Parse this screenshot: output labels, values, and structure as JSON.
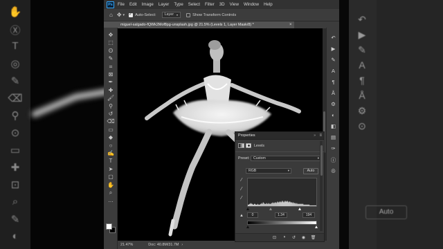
{
  "menubar": {
    "app_icon": "Ps",
    "items": [
      "File",
      "Edit",
      "Image",
      "Layer",
      "Type",
      "Select",
      "Filter",
      "3D",
      "View",
      "Window",
      "Help"
    ]
  },
  "options_bar": {
    "move_icon": "move-tool-icon",
    "auto_select_label": "Auto-Select:",
    "auto_select_target": "Layer",
    "transform_label": "Show Transform Controls",
    "auto_select_checked": true,
    "transform_checked": false
  },
  "document": {
    "tab_title": "miguel-salgado-fQWk2Mof8pg-unsplash.jpg @ 21.5% (Levels 1, Layer Mask/8) *",
    "tab_close": "×"
  },
  "statusbar": {
    "zoom": "21.47%",
    "doc_info": "Doc: 40.8M/31.7M",
    "arrow": "›"
  },
  "properties": {
    "title": "Properties",
    "collapse": "»",
    "menu": "≡",
    "adjustment_label": "Levels",
    "preset_label": "Preset:",
    "preset_value": "Custom",
    "channel_value": "RGB",
    "auto_label": "Auto",
    "input_black": "0",
    "input_gamma": "1.34",
    "input_white": "194",
    "output_black": "0",
    "output_white": "255",
    "caret": "▾"
  },
  "histogram": {
    "description_levels": [
      2,
      2,
      3,
      3,
      4,
      3,
      3,
      2,
      2,
      3,
      3,
      2,
      2,
      2,
      3,
      2,
      2,
      2,
      3,
      3,
      4,
      3,
      5,
      4,
      3,
      3,
      3,
      4,
      3,
      3,
      4,
      3,
      3,
      3,
      4,
      4,
      5,
      4,
      4,
      5,
      5,
      4,
      5,
      6,
      5,
      5,
      6,
      6,
      5,
      6,
      7,
      6,
      5,
      6,
      7,
      6,
      6,
      7,
      6,
      5,
      6,
      6,
      5,
      5,
      5,
      4,
      5,
      4,
      4,
      4,
      3,
      4,
      3,
      3,
      3,
      3,
      3,
      3,
      3,
      3,
      3,
      2,
      2,
      2,
      2,
      2,
      2,
      2,
      2,
      2,
      1,
      1,
      1,
      1,
      1,
      1,
      1,
      1,
      1,
      1
    ]
  },
  "sliders": {
    "input_black_fraction": 0.0,
    "input_gamma_fraction": 0.34,
    "input_white_fraction": 0.76,
    "output_black_fraction": 0.0,
    "output_white_fraction": 1.0
  },
  "icons": {
    "tools_left": [
      "move-icon",
      "artboard-icon",
      "lasso-icon",
      "quick-select-icon",
      "crop-icon",
      "frame-icon",
      "eyedropper-icon",
      "healing-icon",
      "brush-icon",
      "clone-stamp-icon",
      "history-brush-icon",
      "eraser-icon",
      "gradient-icon",
      "blur-icon",
      "dodge-icon",
      "pen-icon",
      "type-icon",
      "path-select-icon",
      "rectangle-icon",
      "hand-icon",
      "zoom-icon",
      "more-tools-icon"
    ],
    "tools_right": [
      "history-icon",
      "play-icon",
      "brush-settings-icon",
      "character-icon",
      "paragraph-icon",
      "glyphs-icon",
      "properties-icon",
      "adjustments-icon",
      "layers-icon",
      "channels-icon",
      "paths-icon",
      "info-icon",
      "libraries-icon"
    ]
  },
  "glyphs": {
    "tools_left": [
      "✥",
      "⬚",
      "ʘ",
      "✎",
      "⌗",
      "⊠",
      "✒",
      "✚",
      "🖌",
      "⚲",
      "↺",
      "⌫",
      "▭",
      "◆",
      "○",
      "✍",
      "T",
      "➤",
      "▢",
      "✋",
      "⌕",
      "…"
    ],
    "tools_right": [
      "↶",
      "▶",
      "✎",
      "A",
      "¶",
      "Å",
      "⚙",
      "◐",
      "◧",
      "▤",
      "✑",
      "ⓘ",
      "◎"
    ],
    "backdrop_left": [
      "✋",
      "Ⓧ",
      "T",
      "◎",
      "✎",
      "⌫",
      "⚲",
      "⊙",
      "▭",
      "✚",
      "⊡",
      "⌕",
      "✎",
      "◐"
    ],
    "backdrop_right": [
      "↶",
      "▶",
      "✎",
      "A",
      "¶",
      "Å",
      "⚙",
      "⊙"
    ],
    "props_footer": [
      "⊡",
      "◑",
      "↺",
      "◉",
      "🗑"
    ],
    "droppers": [
      "⁄",
      "⁄",
      "⁄"
    ],
    "histogram_icon": "▲",
    "backdrop_auto": "Auto"
  }
}
